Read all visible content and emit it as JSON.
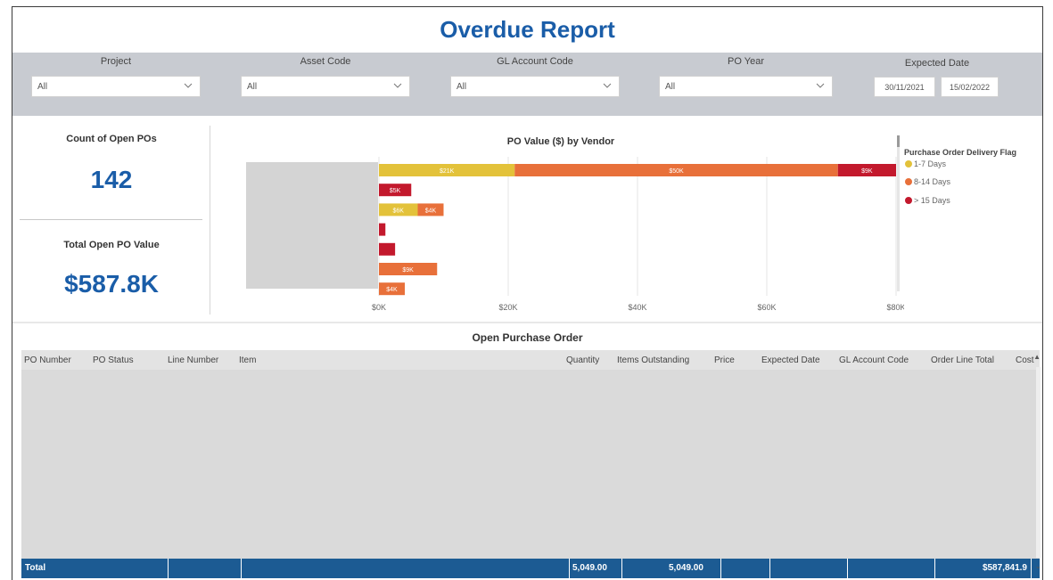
{
  "report": {
    "title": "Overdue Report"
  },
  "filters": {
    "project": {
      "label": "Project",
      "value": "All"
    },
    "asset_code": {
      "label": "Asset Code",
      "value": "All"
    },
    "gl_account_code": {
      "label": "GL Account Code",
      "value": "All"
    },
    "po_year": {
      "label": "PO Year",
      "value": "All"
    },
    "expected_date": {
      "label": "Expected Date",
      "start": "30/11/2021",
      "end": "15/02/2022"
    }
  },
  "cards": {
    "open_pos": {
      "label": "Count of Open POs",
      "value": "142"
    },
    "open_po_value": {
      "label": "Total Open PO Value",
      "value": "$587.8K"
    }
  },
  "chart_data": {
    "type": "bar",
    "orientation": "horizontal",
    "stacked": true,
    "title": "PO Value ($) by Vendor",
    "legend_title": "Purchase Order Delivery Flag",
    "legend_position": "right",
    "xlim": [
      0,
      80
    ],
    "x_unit": "$K",
    "x_ticks": [
      "$0K",
      "$20K",
      "$40K",
      "$60K",
      "$80K"
    ],
    "grid": true,
    "categories": [
      "",
      "",
      "",
      "",
      "",
      "",
      ""
    ],
    "series": [
      {
        "name": "1-7 Days",
        "color": "#e3c23a",
        "values": [
          21,
          0,
          6,
          0,
          0,
          0,
          0
        ],
        "labels": [
          "$21K",
          "",
          "$6K",
          "",
          "",
          "",
          ""
        ]
      },
      {
        "name": "8-14 Days",
        "color": "#e8703a",
        "values": [
          50,
          0,
          4,
          0,
          0,
          9,
          4
        ],
        "labels": [
          "$50K",
          "",
          "$4K",
          "",
          "",
          "$9K",
          "$4K"
        ]
      },
      {
        "name": "> 15 Days",
        "color": "#c3192d",
        "values": [
          9,
          5,
          0,
          1,
          2.5,
          0,
          0
        ],
        "labels": [
          "$9K",
          "$5K",
          "",
          "",
          "",
          "",
          ""
        ]
      }
    ]
  },
  "table": {
    "title": "Open Purchase Order",
    "columns": [
      "PO Number",
      "PO Status",
      "Line Number",
      "Item",
      "Quantity",
      "Items Outstanding",
      "Price",
      "Expected Date",
      "GL Account Code",
      "Order Line Total",
      "Cost"
    ],
    "total_label": "Total",
    "total_quantity": "5,049.00",
    "total_items_outstanding": "5,049.00",
    "total_order_line": "$587,841.9"
  },
  "icons": {
    "chevron": "chevron-down-icon",
    "scroll_up": "caret-up-icon",
    "scroll_down": "caret-down-icon"
  }
}
